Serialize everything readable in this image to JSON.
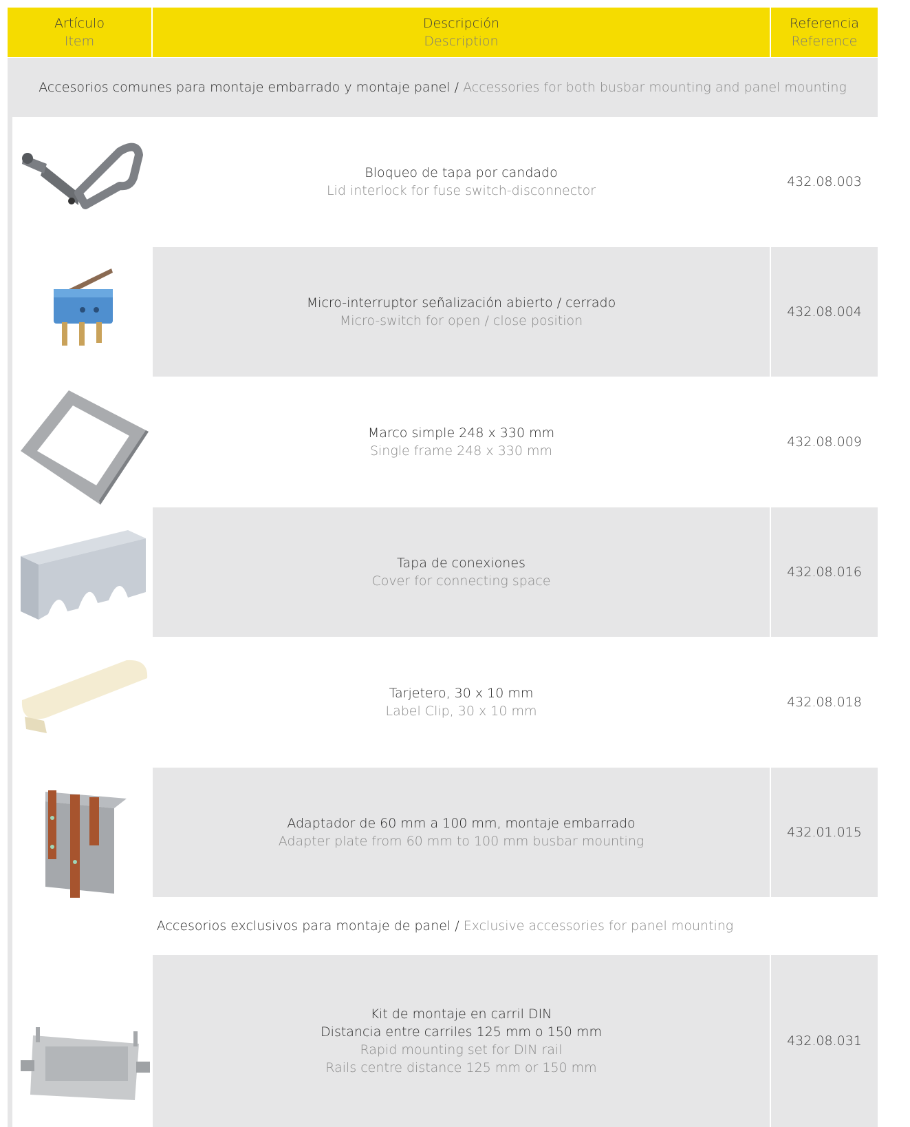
{
  "header": {
    "item_es": "Artículo",
    "item_en": "Item",
    "desc_es": "Descripción",
    "desc_en": "Description",
    "ref_es": "Referencia",
    "ref_en": "Reference"
  },
  "section_common": {
    "es": "Accesorios comunes para montaje embarrado y montaje panel",
    "sep": " / ",
    "en": "Accessories for both busbar mounting and panel mounting"
  },
  "rows": [
    {
      "es": "Bloqueo de tapa por candado",
      "en": "Lid interlock for fuse switch-disconnector",
      "ref": "432.08.003",
      "icon": "padlock-lid-interlock-icon"
    },
    {
      "es": "Micro-interruptor señalización abierto / cerrado",
      "en": "Micro-switch for open / close position",
      "ref": "432.08.004",
      "icon": "micro-switch-icon"
    },
    {
      "es": "Marco simple 248 x 330 mm",
      "en": "Single frame 248 x 330 mm",
      "ref": "432.08.009",
      "icon": "frame-icon"
    },
    {
      "es": "Tapa de conexiones",
      "en": "Cover for connecting space",
      "ref": "432.08.016",
      "icon": "connection-cover-icon"
    },
    {
      "es": "Tarjetero, 30 x 10 mm",
      "en": "Label Clip, 30 x 10 mm",
      "ref": "432.08.018",
      "icon": "label-clip-icon"
    },
    {
      "es": "Adaptador de 60 mm a 100 mm, montaje embarrado",
      "en": "Adapter plate from 60 mm to 100 mm busbar mounting",
      "ref": "432.01.015",
      "icon": "adapter-plate-icon"
    }
  ],
  "section_panel": {
    "es": "Accesorios exclusivos para montaje de panel",
    "sep": " / ",
    "en": "Exclusive accessories for panel mounting"
  },
  "last_row": {
    "es1": "Kit de montaje en carril DIN",
    "es2": "Distancia entre carriles 125 mm o 150 mm",
    "en1": "Rapid mounting set for DIN rail",
    "en2": "Rails centre distance 125 mm or 150 mm",
    "ref": "432.08.031",
    "icon": "din-rail-kit-icon"
  }
}
